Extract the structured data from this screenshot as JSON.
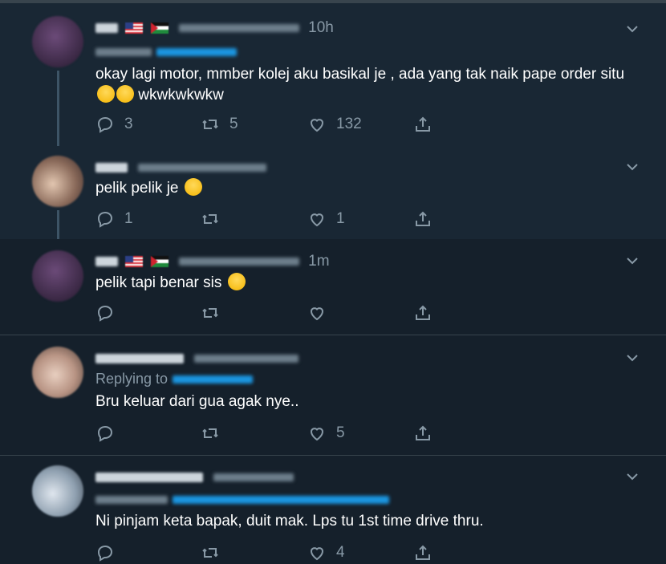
{
  "tweets": [
    {
      "time": "10h",
      "replying": "",
      "text": "okay lagi motor, mmber kolej aku basikal je , ada yang tak naik pape order situ",
      "text_tail": "wkwkwkwkw",
      "replies": "3",
      "retweets": "5",
      "likes": "132"
    },
    {
      "time": "",
      "replying": "",
      "text": "pelik pelik je",
      "replies": "1",
      "retweets": "",
      "likes": "1"
    },
    {
      "time": "1m",
      "replying": "",
      "text": "pelik tapi benar sis",
      "replies": "",
      "retweets": "",
      "likes": ""
    },
    {
      "time": "",
      "replying": "Replying to",
      "text": "Bru keluar dari gua agak nye..",
      "replies": "",
      "retweets": "",
      "likes": "5"
    },
    {
      "time": "",
      "replying": "",
      "text": "Ni pinjam keta bapak, duit mak. Lps tu 1st time drive thru.",
      "replies": "",
      "retweets": "",
      "likes": "4"
    }
  ],
  "icons": [
    "reply-icon",
    "retweet-icon",
    "like-icon",
    "share-icon",
    "chevron-down-icon"
  ],
  "colors": {
    "background": "#15202b",
    "highlight": "#192734",
    "muted": "#8899a6",
    "link": "#1b95e0",
    "border": "#38444d"
  }
}
